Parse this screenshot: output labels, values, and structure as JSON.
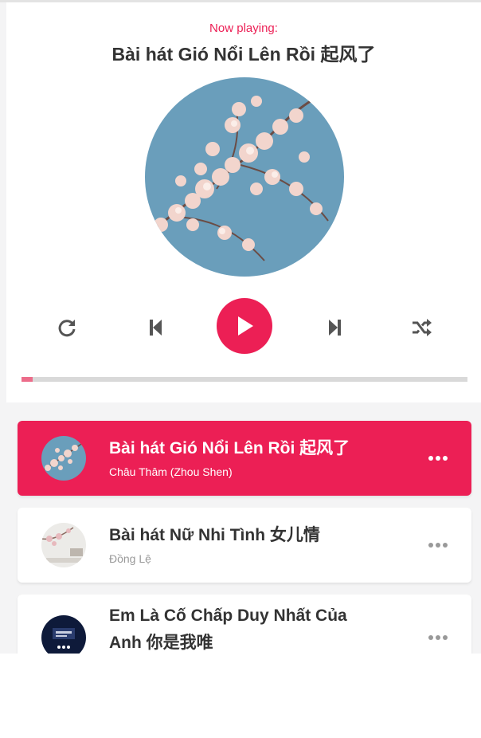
{
  "player": {
    "now_playing_label": "Now playing:",
    "current_title": "Bài hát Gió Nổi Lên Rồi 起风了",
    "progress_fraction": 0.025
  },
  "controls": {
    "repeat_icon": "repeat-icon",
    "prev_icon": "step-backward-icon",
    "play_icon": "play-icon",
    "next_icon": "step-forward-icon",
    "random_icon": "shuffle-icon"
  },
  "playlist": [
    {
      "title": "Bài hát Gió Nổi Lên Rồi 起风了",
      "author": "Châu Thâm (Zhou Shen)",
      "active": true
    },
    {
      "title": "Bài hát Nữ Nhi Tình 女儿情",
      "author": "Đồng Lệ",
      "active": false
    },
    {
      "title": "Em Là Cố Chấp Duy Nhất Của Anh 你是我唯",
      "author": "",
      "active": false
    }
  ],
  "colors": {
    "accent": "#ec1f55",
    "progress_fill": "#ec6c8a",
    "track": "#d9d9d9",
    "text_dark": "#333333",
    "text_muted": "#999999"
  }
}
